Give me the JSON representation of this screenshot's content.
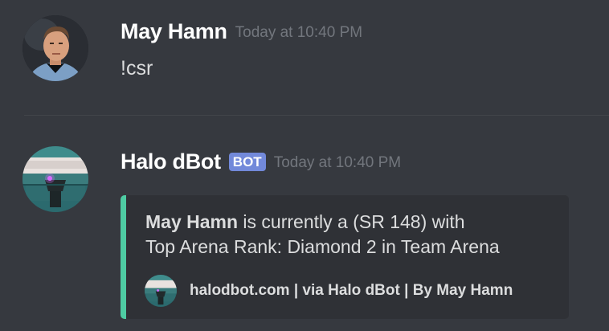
{
  "messages": [
    {
      "username": "May Hamn",
      "timestamp": "Today at 10:40 PM",
      "content": "!csr",
      "avatar_icon": "user-avatar-icon"
    },
    {
      "username": "Halo dBot",
      "badge": "BOT",
      "timestamp": "Today at 10:40 PM",
      "avatar_icon": "bot-avatar-icon",
      "embed": {
        "accent_color": "#4ecca3",
        "desc_bold": "May Hamn",
        "desc_line1_rest": " is currently a (SR 148) with",
        "desc_line2": "Top Arena Rank: Diamond 2 in Team Arena",
        "footer_text": "halodbot.com | via Halo dBot | By May Hamn",
        "footer_icon": "bot-footer-icon"
      }
    }
  ],
  "colors": {
    "background": "#36393f",
    "embed_background": "#2f3136",
    "bot_badge": "#7289da",
    "timestamp": "#72767d"
  }
}
